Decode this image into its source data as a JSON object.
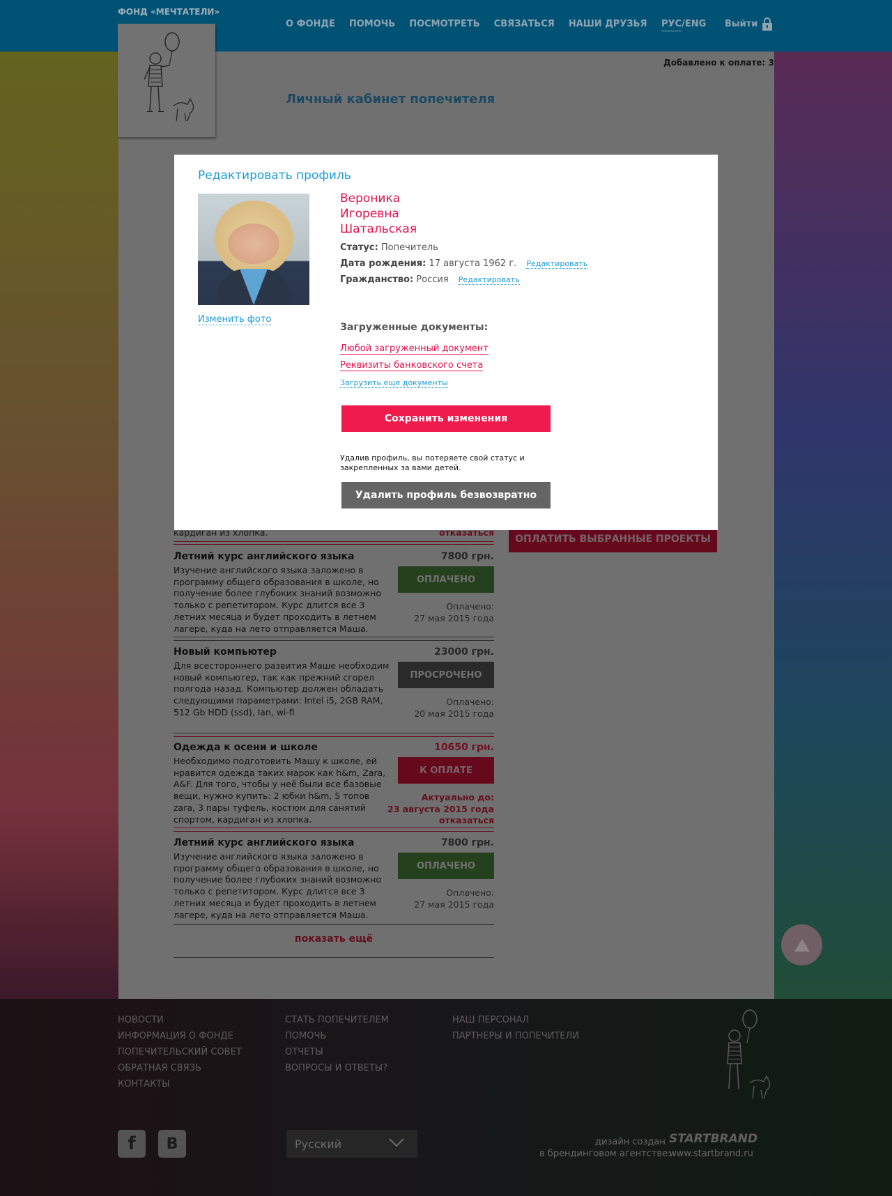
{
  "header": {
    "org_name": "ФОНД «МЕЧТАТЕЛИ»",
    "nav": [
      "О ФОНДЕ",
      "ПОМОЧЬ",
      "ПОСМОТРЕТЬ",
      "СВЯЗАТЬСЯ",
      "НАШИ ДРУЗЬЯ"
    ],
    "lang_active": "РУС",
    "lang_sep": "/",
    "lang_other": "ENG",
    "logout": "Выйти"
  },
  "added_to_payment": "Добавлено к оплате: 3",
  "page_title": "Личный кабинет попечителя",
  "projects_top": {
    "partial_desc": "кардиган из хлопка.",
    "partial_refuse": "отказаться",
    "pay_selected": "ОПЛАТИТЬ ВЫБРАННЫЕ ПРОЕКТЫ"
  },
  "projects": [
    {
      "title": "Летний курс английского языка",
      "price": "7800 грн.",
      "desc": "Изучение английского языка заложено в программу общего образования в школе, но получение более глубоких знаний возможно только с репетитором. Курс длится все 3 летних месяца и будет проходить в летнем лагере, куда на лето отправляется Маша.",
      "button": "ОПЛАЧЕНО",
      "date_label": "Оплачено:",
      "date": "27 мая 2015 года"
    },
    {
      "title": "Новый компьютер",
      "price": "23000 грн.",
      "desc": "Для всестороннего развития Маше необходим новый компьютер, так как прежний сгорел полгода назад. Компьютер должен обладать следующими параметрами: Intel i5, 2GB RAM, 512 Gb HDD (ssd), lan, wi-fi",
      "button": "ПРОСРОЧЕНО",
      "date_label": "Оплачено:",
      "date": "20 мая 2015 года"
    },
    {
      "title": "Одежда к осени и школе",
      "price": "10650 грн.",
      "desc": "Необходимо подготовить Машу к школе, ей нравится одежда таких марок как h&m, Zara, A&F. Для того, чтобы у неё были все базовые вещи, нужно купить: 2 юбки h&m, 5 топов zara, 3 пары туфель, костюм для санятий спортом, кардиган из хлопка.",
      "button": "К ОПЛАТЕ",
      "date_label": "Актуально до:",
      "date": "23 августа 2015 года",
      "refuse": "отказаться"
    },
    {
      "title": "Летний курс английского языка",
      "price": "7800 грн.",
      "desc": "Изучение английского языка заложено в программу общего образования в школе, но получение более глубоких знаний возможно только с репетитором. Курс длится все 3 летних месяца и будет проходить в летнем лагере, куда на лето отправляется Маша.",
      "button": "ОПЛАЧЕНО",
      "date_label": "Оплачено:",
      "date": "27 мая 2015 года"
    }
  ],
  "show_more": "показать ещё",
  "modal": {
    "title": "Редактировать профиль",
    "change_photo": "Изменить фото",
    "name_first": "Вероника",
    "name_middle": "Игоревна",
    "name_last": "Шатальская",
    "status_label": "Статус:",
    "status_value": "Попечитель",
    "birth_label": "Дата рождения:",
    "birth_value": "17 августа 1962 г.",
    "citizenship_label": "Гражданство:",
    "citizenship_value": "Россия",
    "edit": "Редактировать",
    "docs_title": "Загруженные документы:",
    "doc1": "Любой загруженный документ",
    "doc2": "Реквизиты банковского счета",
    "upload_more": "Загрузить еще документы",
    "save": "Сохранить изменения",
    "warning": "Удалив профиль, вы потеряете свой статус и закрепленных за вами детей.",
    "delete": "Удалить профиль безвозвратно"
  },
  "footer": {
    "col1": [
      "НОВОСТИ",
      "ИНФОРМАЦИЯ О ФОНДЕ",
      "ПОПЕЧИТЕЛЬСКИЙ СОВЕТ",
      "ОБРАТНАЯ СВЯЗЬ",
      "КОНТАКТЫ"
    ],
    "col2": [
      "СТАТЬ ПОПЕЧИТЕЛЕМ",
      "ПОМОЧЬ",
      "ОТЧЕТЫ",
      "ВОПРОСЫ И ОТВЕТЫ?"
    ],
    "col3": [
      "НАШ ПЕРСОНАЛ",
      "ПАРТНЕРЫ И ПОПЕЧИТЕЛИ"
    ],
    "language": "Русский",
    "credit_line1": "дизайн создан",
    "credit_line2": "в брендинговом агентстве:",
    "agency": "STARTBRAND",
    "agency_url": "www.startbrand.ru",
    "social": [
      "facebook-icon",
      "vk-icon"
    ]
  },
  "colors": {
    "accent_blue": "#1b9bd7",
    "accent_red": "#ef1b4c",
    "header_bg": "#00587d"
  }
}
